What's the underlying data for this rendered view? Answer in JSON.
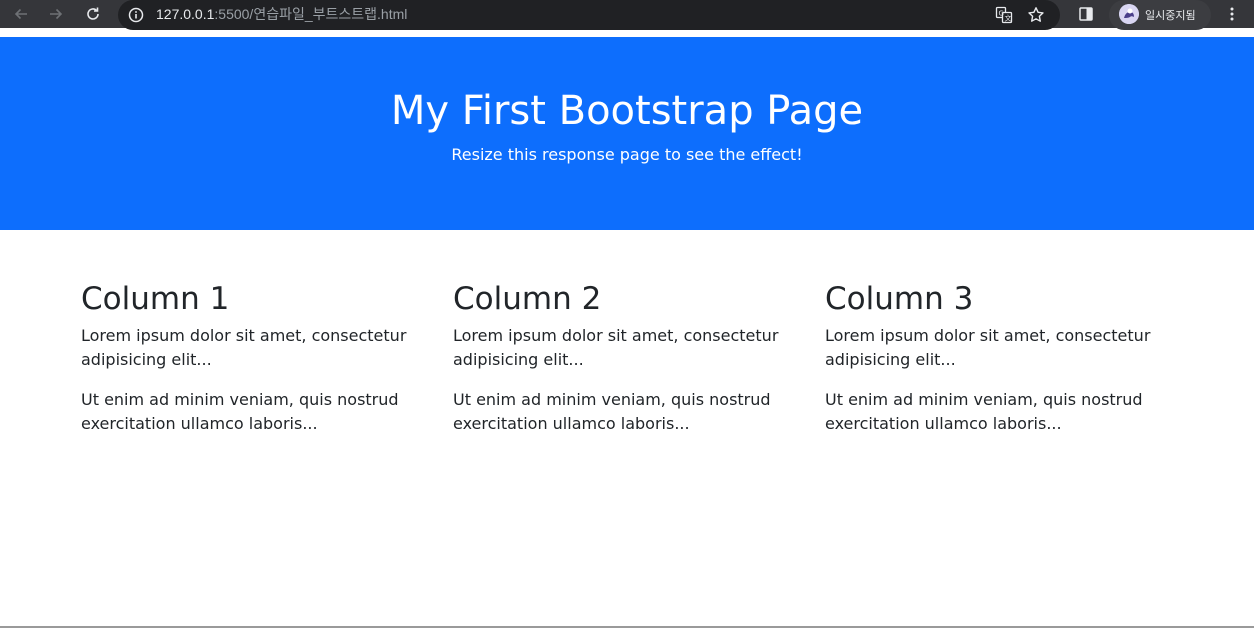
{
  "browser": {
    "url_host": "127.0.0.1",
    "url_rest": ":5500/연습파일_부트스트랩.html",
    "profile_label": "일시중지됨",
    "icons": {
      "back": "arrow-left-icon",
      "forward": "arrow-right-icon",
      "reload": "reload-icon",
      "site_info": "info-icon",
      "translate": "translate-icon",
      "bookmark": "star-icon",
      "side_panel": "side-panel-icon",
      "menu": "kebab-menu-icon"
    },
    "colors": {
      "toolbar": "#35363a",
      "omnibox": "#202124"
    }
  },
  "jumbotron": {
    "title": "My First Bootstrap Page",
    "subtitle": "Resize this response page to see the effect!",
    "background": "#0d6efd"
  },
  "columns": [
    {
      "heading": "Column 1",
      "p1": "Lorem ipsum dolor sit amet, consectetur adipisicing elit...",
      "p2": "Ut enim ad minim veniam, quis nostrud exercitation ullamco laboris..."
    },
    {
      "heading": "Column 2",
      "p1": "Lorem ipsum dolor sit amet, consectetur adipisicing elit...",
      "p2": "Ut enim ad minim veniam, quis nostrud exercitation ullamco laboris..."
    },
    {
      "heading": "Column 3",
      "p1": "Lorem ipsum dolor sit amet, consectetur adipisicing elit...",
      "p2": "Ut enim ad minim veniam, quis nostrud exercitation ullamco laboris..."
    }
  ]
}
